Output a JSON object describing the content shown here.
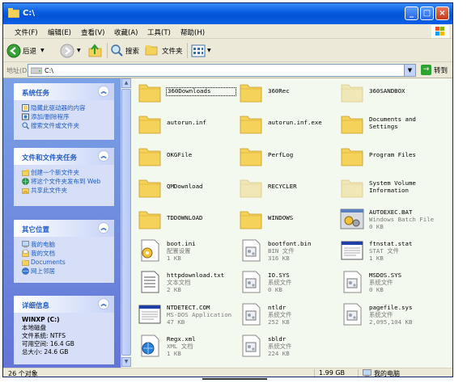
{
  "window": {
    "title": "C:\\"
  },
  "menu": [
    "文件(F)",
    "编辑(E)",
    "查看(V)",
    "收藏(A)",
    "工具(T)",
    "帮助(H)"
  ],
  "toolbar": {
    "back": "后退",
    "search": "搜索",
    "folders": "文件夹"
  },
  "address": {
    "label": "地址(D)",
    "value": "C:\\",
    "go": "转到"
  },
  "panels": {
    "system_tasks": {
      "title": "系统任务",
      "items": [
        "隐藏此驱动器的内容",
        "添加/删除程序",
        "搜索文件或文件夹"
      ]
    },
    "file_tasks": {
      "title": "文件和文件夹任务",
      "items": [
        "创建一个新文件夹",
        "将这个文件夹发布到 Web",
        "共享此文件夹"
      ]
    },
    "other_places": {
      "title": "其它位置",
      "items": [
        "我的电脑",
        "我的文档",
        "Documents",
        "网上邻居"
      ]
    },
    "details": {
      "title": "详细信息",
      "drive_name": "WINXP (C:)",
      "drive_type": "本地磁盘",
      "fs": "文件系统: NTFS",
      "free": "可用空间: 16.4 GB",
      "total": "总大小: 24.6 GB"
    }
  },
  "files": [
    {
      "name": "360Downloads",
      "type": "folder",
      "selected": true
    },
    {
      "name": "360Rec",
      "type": "folder"
    },
    {
      "name": "360SANDBOX",
      "type": "folder",
      "faded": true
    },
    {
      "name": "autorun.inf",
      "type": "folder"
    },
    {
      "name": "autorun.inf.exe",
      "type": "folder"
    },
    {
      "name": "Documents and\nSettings",
      "type": "folder"
    },
    {
      "name": "OKGFile",
      "type": "folder"
    },
    {
      "name": "PerfLog",
      "type": "folder"
    },
    {
      "name": "Program Files",
      "type": "folder"
    },
    {
      "name": "QMDownload",
      "type": "folder"
    },
    {
      "name": "RECYCLER",
      "type": "folder",
      "faded": true
    },
    {
      "name": "System Volume\nInformation",
      "type": "folder",
      "faded": true
    },
    {
      "name": "TDDOWNLOAD",
      "type": "folder"
    },
    {
      "name": "WINDOWS",
      "type": "folder"
    },
    {
      "name": "AUTOEXEC.BAT",
      "type": "bat",
      "desc": "Windows Batch File",
      "size": "0 KB"
    },
    {
      "name": "boot.ini",
      "type": "ini",
      "desc": "配置设置",
      "size": "1 KB"
    },
    {
      "name": "bootfont.bin",
      "type": "sys",
      "desc": "BIN 文件",
      "size": "316 KB"
    },
    {
      "name": "ftnstat.stat",
      "type": "win",
      "desc": "STAT 文件",
      "size": "1 KB"
    },
    {
      "name": "httpdownload.txt",
      "type": "txt",
      "desc": "文本文档",
      "size": "2 KB"
    },
    {
      "name": "IO.SYS",
      "type": "sys",
      "desc": "系统文件",
      "size": "0 KB"
    },
    {
      "name": "MSDOS.SYS",
      "type": "sys",
      "desc": "系统文件",
      "size": "0 KB"
    },
    {
      "name": "NTDETECT.COM",
      "type": "com",
      "desc": "MS-DOS Application",
      "size": "47 KB"
    },
    {
      "name": "ntldr",
      "type": "sys",
      "desc": "系统文件",
      "size": "252 KB"
    },
    {
      "name": "pagefile.sys",
      "type": "sys",
      "desc": "系统文件",
      "size": "2,095,104 KB"
    },
    {
      "name": "Regx.xml",
      "type": "xml",
      "desc": "XML 文档",
      "size": "1 KB"
    },
    {
      "name": "sbldr",
      "type": "sys",
      "desc": "系统文件",
      "size": "224 KB"
    }
  ],
  "status": {
    "count": "26 个对象",
    "size": "1.99 GB",
    "location": "我的电脑"
  },
  "colors": {
    "folder": "#f5d25a",
    "title_blue": "#0453d6",
    "content_bg": "#f4f9ef",
    "link_blue": "#215dc6"
  }
}
